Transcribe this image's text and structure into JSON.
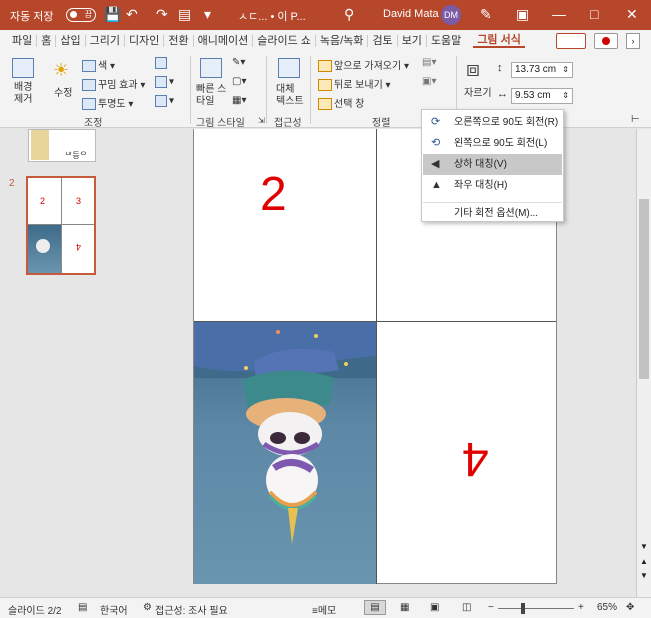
{
  "titlebar": {
    "autosave_label": "자동 저장",
    "autosave_state": "끔",
    "doc_title": "ㅅㄷ... • 이 P...",
    "user_name": "David Mata",
    "user_initials": "DM"
  },
  "menubar": {
    "tabs": [
      "파일",
      "홈",
      "삽입",
      "그리기",
      "디자인",
      "전환",
      "애니메이션",
      "슬라이드 쇼",
      "녹음/녹화",
      "검토",
      "보기",
      "도움말"
    ],
    "active_tab": "그림 서식"
  },
  "ribbon": {
    "remove_bg": "배경 제거",
    "corrections": "수정",
    "color": "색",
    "artistic": "꾸밈 효과",
    "transparency": "투명도",
    "group_adjust": "조정",
    "quick_styles": "빠른 스타일",
    "group_styles": "그림 스타일",
    "alt_text": "대체 텍스트",
    "group_access": "접근성",
    "bring_forward": "앞으로 가져오기",
    "send_backward": "뒤로 보내기",
    "selection_pane": "선택 창",
    "group_arrange": "정렬",
    "crop": "자르기",
    "height": "13.73 cm",
    "width": "9.53 cm"
  },
  "rotate_menu": {
    "items": [
      "오른쪽으로 90도 회전(R)",
      "왼쪽으로 90도 회전(L)",
      "상하 대칭(V)",
      "좌우 대칭(H)",
      "기타 회전 옵션(M)..."
    ]
  },
  "slides": {
    "current_number": "2",
    "thumb_labels": [
      "2",
      "3",
      "4"
    ]
  },
  "slide": {
    "cell_top_left": "2",
    "cell_bottom_right": "4"
  },
  "statusbar": {
    "slide_info": "슬라이드 2/2",
    "language": "한국어",
    "accessibility": "접근성: 조사 필요",
    "notes": "메모",
    "zoom": "65%"
  }
}
